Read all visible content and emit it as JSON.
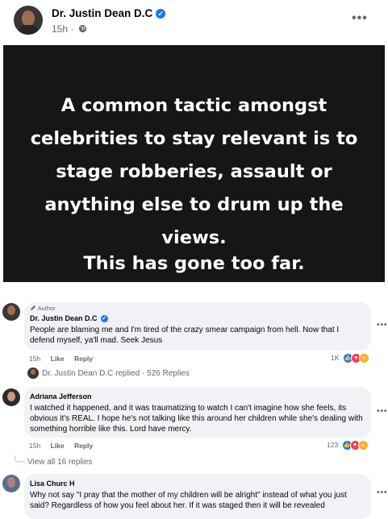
{
  "post": {
    "author": "Dr. Justin Dean D.C",
    "time": "15h ·",
    "globe_icon": "globe-icon",
    "more": "•••",
    "image_text_main": "A common tactic amongst celebrities to stay relevant is to stage robberies, assault or anything else to drum up the views.",
    "image_text_second": "This has gone too far."
  },
  "comments": [
    {
      "badge": "Author",
      "name": "Dr. Justin Dean D.C",
      "text": "People are blaming me and I'm tired of the crazy smear campaign from hell. Now that I defend myself, ya'll mad. Seek Jesus",
      "time": "15h",
      "like": "Like",
      "reply": "Reply",
      "reactions_count": "1K",
      "replied_text": "Dr. Justin Dean D.C replied · 526 Replies"
    },
    {
      "name": "Adriana Jefferson",
      "text": "I watched it happened, and it was traumatizing to watch I can't imagine how she feels, its obvious it's REAL. I hope he's not talking like this around her children while she's dealing with something horrible like this. Lord have mercy.",
      "time": "15h",
      "like": "Like",
      "reply": "Reply",
      "reactions_count": "123",
      "view_replies": "View all 16 replies"
    },
    {
      "name": "Lisa Churc H",
      "text": "Why not say \"I pray that the mother of my children will be alright\" instead of what you just said? Regardless of how you feel about her. If it was staged then it will be revealed"
    }
  ],
  "more": "•••"
}
